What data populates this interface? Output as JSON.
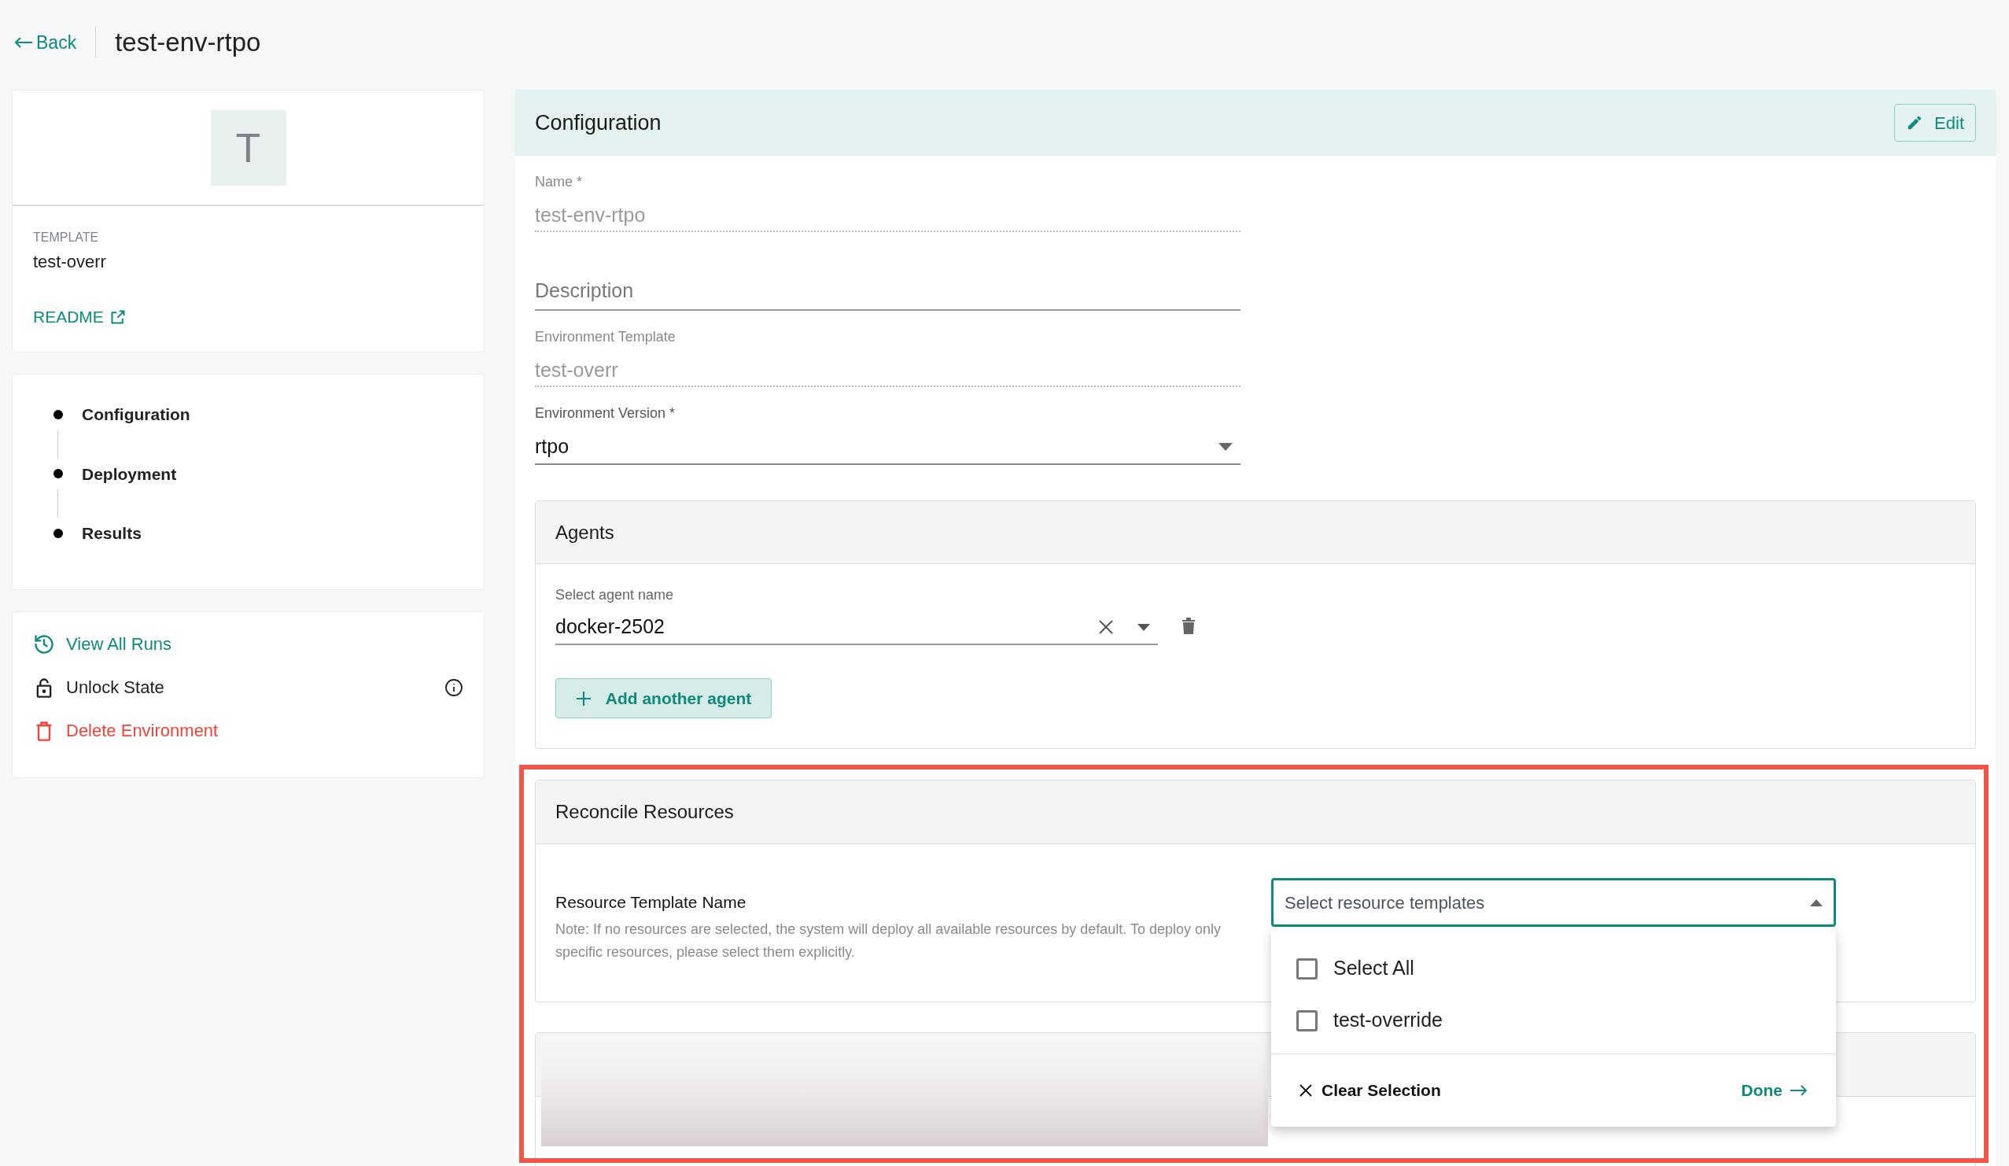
{
  "header": {
    "back": "Back",
    "title": "test-env-rtpo"
  },
  "sidebar": {
    "avatar": "T",
    "template_label": "TEMPLATE",
    "template": "test-overr",
    "readme": "README",
    "steps": [
      {
        "label": "Configuration"
      },
      {
        "label": "Deployment"
      },
      {
        "label": "Results"
      }
    ],
    "actions": [
      {
        "kind": "history",
        "label": "View All Runs"
      },
      {
        "kind": "lock",
        "label": "Unlock State"
      },
      {
        "kind": "delete",
        "label": "Delete Environment"
      }
    ]
  },
  "configuration": {
    "title": "Configuration",
    "edit": "Edit",
    "fields": [
      {
        "kind": "readonly",
        "label": "Name *",
        "value": "test-env-rtpo"
      },
      {
        "kind": "empty",
        "placeholder": "Description"
      },
      {
        "kind": "readonly",
        "label": "Environment Template",
        "value": "test-overr"
      },
      {
        "kind": "select",
        "label": "Environment Version *",
        "value": "rtpo"
      }
    ]
  },
  "agents": {
    "title": "Agents",
    "field_label": "Select agent name",
    "value": "docker-2502",
    "add": "Add another agent"
  },
  "reconcile": {
    "title": "Reconcile Resources",
    "field_label": "Resource Template Name",
    "note": "Note: If no resources are selected, the system will deploy all available resources by default. To deploy only specific resources, please select them explicitly.",
    "placeholder": "Select resource templates",
    "options": [
      {
        "label": "Select All",
        "checked": false
      },
      {
        "label": "test-override",
        "checked": false
      }
    ],
    "clear": "Clear Selection",
    "done": "Done"
  }
}
